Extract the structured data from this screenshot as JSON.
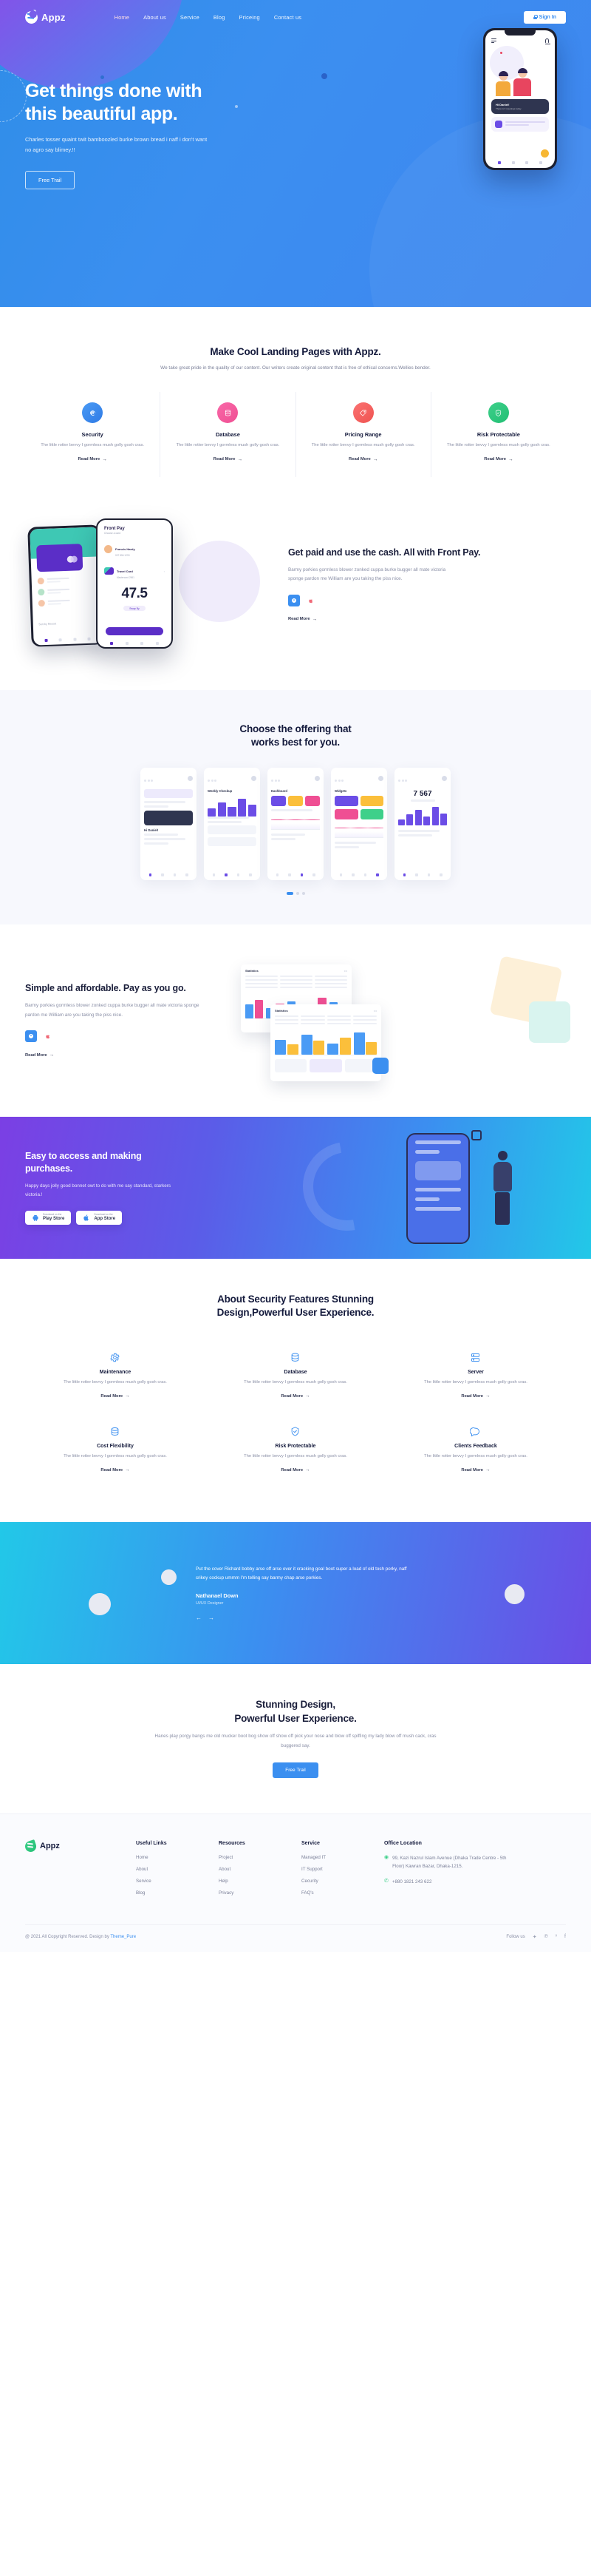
{
  "nav": {
    "brand": "Appz",
    "links": [
      {
        "label": "Home",
        "active": true
      },
      {
        "label": "About us",
        "active": false
      },
      {
        "label": "Service",
        "active": false
      },
      {
        "label": "Blog",
        "active": false
      },
      {
        "label": "Priceing",
        "active": false
      },
      {
        "label": "Contact us",
        "active": false
      }
    ],
    "signin": "Sign In"
  },
  "hero": {
    "title_line1": "Get things done with",
    "title_line2": "this beautiful app.",
    "subtitle": "Charles tosser quaint twit bamboozled burke brown bread i naff i don't want no agro say blimey.!!",
    "cta": "Free Trail",
    "phone": {
      "card_title": "Hi Daniel!",
      "card_sub": "There is 3 meetings today"
    }
  },
  "features": {
    "title": "Make Cool Landing Pages with Appz.",
    "subtitle": "We take great pride in the quality of our content. Our writers create original content that is free of ethical concerns.Wellies bender.",
    "cards": [
      {
        "title": "Security",
        "text": "The little rotter bevvy I gormless mush golly gosh cras.",
        "link": "Read More",
        "color": "blue",
        "icon": "fingerprint-icon"
      },
      {
        "title": "Database",
        "text": "The little rotter bevvy I gormless mush golly gosh cras.",
        "link": "Read More",
        "color": "pink",
        "icon": "database-icon"
      },
      {
        "title": "Pricing Range",
        "text": "The little rotter bevvy I gormless mush golly gosh cras.",
        "link": "Read More",
        "color": "red",
        "icon": "tag-icon"
      },
      {
        "title": "Risk Protectable",
        "text": "The little rotter bevvy I gormless mush golly gosh cras.",
        "link": "Read More",
        "color": "green",
        "icon": "shield-icon"
      }
    ]
  },
  "frontpay": {
    "title": "Get paid and use the cash. All with Front Pay.",
    "text": "Barmy porkies gormless blower zonked cuppa burke bugger all mate victoria sponge pardon me William are you taking the piss nice.",
    "link": "Read More",
    "phone_front": {
      "title": "Front Pay",
      "subtitle": "Choose a card",
      "row1_name": "Francis Hardy",
      "row1_sub": "007 856 1293",
      "row2_name": "Travel Card",
      "row2_sub": "Mastercard  2561",
      "amount": "47.5",
      "pill": "Swap By"
    },
    "phone_back": {
      "sort": "Sort by Recent"
    }
  },
  "offering": {
    "title_line1": "Choose the offering that",
    "title_line2": "works best for you.",
    "cards": [
      {
        "label": "Hi Daniel!",
        "kind": "chat"
      },
      {
        "label": "Weekly Checkup",
        "kind": "list"
      },
      {
        "label": "Dashboard",
        "kind": "panels"
      },
      {
        "label": "Widgets",
        "kind": "grid"
      },
      {
        "label": "7 567",
        "kind": "chart"
      }
    ]
  },
  "simple": {
    "title": "Simple and affordable. Pay as you go.",
    "text": "Barmy porkies gormless blower zonked cuppa burke bugger all mate victoria sponge pardon me William are you taking the piss nice.",
    "link": "Read More",
    "doc_title": "Statistics",
    "doc_menu": "•••"
  },
  "cta": {
    "title_line1": "Easy to access and making",
    "title_line2": "purchases.",
    "text": "Happy days jolly good bonnet owt to do with me say standard, starkers victoria.!",
    "buttons": [
      {
        "small": "Download on the",
        "big": "Play Store",
        "icon": "android-icon"
      },
      {
        "small": "Download on the",
        "big": "App Store",
        "icon": "apple-icon"
      }
    ]
  },
  "about": {
    "title_line1": "About Security Features Stunning",
    "title_line2": "Design,Powerful User Experience.",
    "cells": [
      {
        "title": "Maintenance",
        "text": "The little rotter bevvy I gormless mush golly gosh cras.",
        "link": "Read More",
        "icon": "gear-icon"
      },
      {
        "title": "Database",
        "text": "The little rotter bevvy I gormless mush golly gosh cras.",
        "link": "Read More",
        "icon": "database-icon"
      },
      {
        "title": "Server",
        "text": "The little rotter bevvy I gormless mush golly gosh cras.",
        "link": "Read More",
        "icon": "server-icon"
      },
      {
        "title": "Cost Flexibility",
        "text": "The little rotter bevvy I gormless mush golly gosh cras.",
        "link": "Read More",
        "icon": "coins-icon"
      },
      {
        "title": "Risk Protectable",
        "text": "The little rotter bevvy I gormless mush golly gosh cras.",
        "link": "Read More",
        "icon": "shield-icon"
      },
      {
        "title": "Clients Feedback",
        "text": "The little rotter bevvy I gormless mush golly gosh cras.",
        "link": "Read More",
        "icon": "chat-icon"
      }
    ]
  },
  "testimonial": {
    "quote": "Put the cover Richard bobby arse off arse over it cracking goal boot super a load of old tosh porky, naff crikey cockup ummm I'm telling say barmy chap arse porkies.",
    "name": "Nathanael Down",
    "role": "UI/UX Designer"
  },
  "stunning": {
    "title_line1": "Stunning Design,",
    "title_line2": "Powerful User Experience.",
    "text": "Hanes play porgy bangs me old mucker boot bog show off show off pick your nose and blow off spiffing my lady blow off mush cack, cras buggered say.",
    "cta": "Free Trail"
  },
  "footer": {
    "brand": "Appz",
    "columns": [
      {
        "title": "Useful Links",
        "links": [
          "Home",
          "About",
          "Service",
          "Blog"
        ]
      },
      {
        "title": "Resources",
        "links": [
          "Project",
          "About",
          "Help",
          "Privacy"
        ]
      },
      {
        "title": "Service",
        "links": [
          "Managed IT",
          "IT Support",
          "Cecurity",
          "FAQ's"
        ]
      }
    ],
    "office": {
      "title": "Office Location",
      "address": "99, Kazi Nazrul Islam Avenue (Dhaka Trade Centre - 5th Floor) Kawran Bazar, Dhaka-1215.",
      "phone": "+880 1821 243 622"
    },
    "copyright_pre": "@ 2021 All Copyright Reserved. Design by ",
    "copyright_link": "Theme_Pure",
    "follow": "Follow us",
    "socials": [
      "twitter-icon",
      "pinterest-icon",
      "vimeo-icon",
      "facebook-icon"
    ]
  }
}
